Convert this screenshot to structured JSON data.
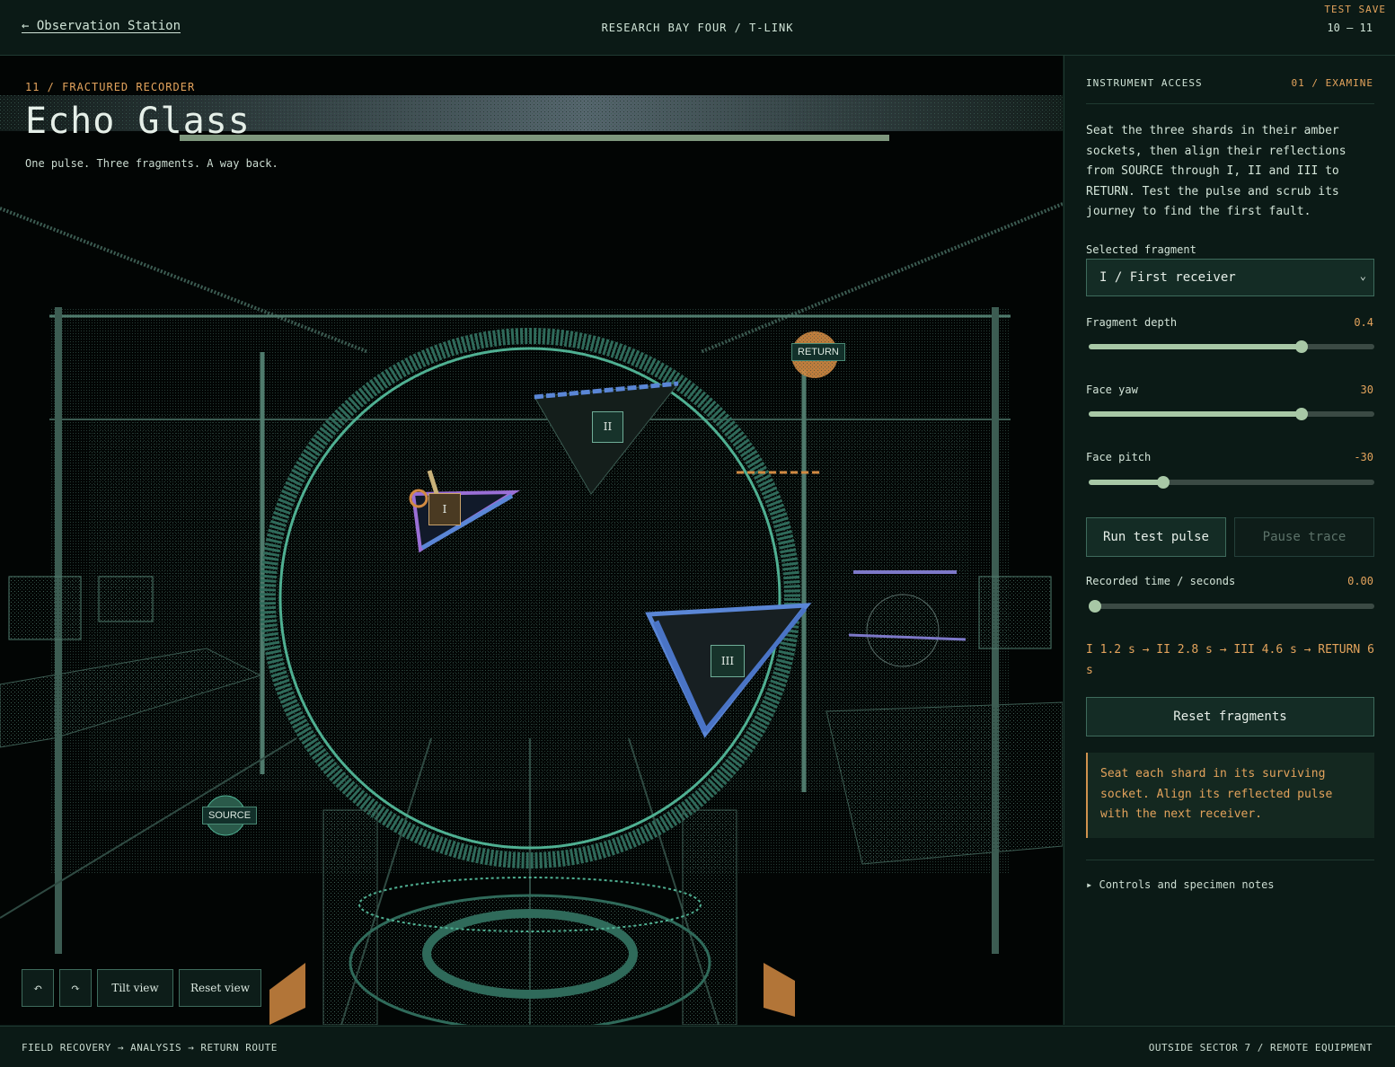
{
  "header": {
    "back_label": "← Observation Station",
    "breadcrumb": "RESEARCH BAY FOUR / T-LINK",
    "save_tag": "TEST SAVE",
    "page_range": "10 — 11"
  },
  "scene": {
    "eyebrow": "11 / FRACTURED RECORDER",
    "title": "Echo Glass",
    "subtitle": "One pulse. Three fragments. A way back.",
    "source_label": "SOURCE",
    "return_label": "RETURN",
    "markers": [
      "I",
      "II",
      "III"
    ],
    "controls": {
      "rotate_left": "↶",
      "rotate_right": "↷",
      "tilt": "Tilt view",
      "reset": "Reset view"
    }
  },
  "panel": {
    "heading": "INSTRUMENT ACCESS",
    "step": "01 / EXAMINE",
    "intro": "Seat the three shards in their amber sockets, then align their reflections from SOURCE through I, II and III to RETURN. Test the pulse and scrub its journey to find the first fault.",
    "fragment_label": "Selected fragment",
    "fragment_value": "I / First receiver",
    "sliders": [
      {
        "label": "Fragment depth",
        "value": "0.4",
        "fraction": 0.745
      },
      {
        "label": "Face yaw",
        "value": "30",
        "fraction": 0.745
      },
      {
        "label": "Face pitch",
        "value": "-30",
        "fraction": 0.262
      }
    ],
    "run_label": "Run test pulse",
    "pause_label": "Pause trace",
    "time_label": "Recorded time / seconds",
    "time_value": "0.00",
    "time_fraction": 0.0,
    "route": "I 1.2 s → II 2.8 s → III 4.6 s → RETURN 6 s",
    "reset_label": "Reset fragments",
    "notice": "Seat each shard in its surviving socket. Align its reflected pulse with the next receiver.",
    "details_label": "Controls and specimen notes"
  },
  "footer": {
    "left": "FIELD RECOVERY → ANALYSIS → RETURN ROUTE",
    "right": "OUTSIDE SECTOR 7 / REMOTE EQUIPMENT"
  },
  "colors": {
    "background": "#0a1814",
    "accent_amber": "#e3a35c",
    "accent_teal": "#4fb092",
    "shard_blue": "#5a86d6",
    "shard_violet": "#9a6fd6"
  }
}
